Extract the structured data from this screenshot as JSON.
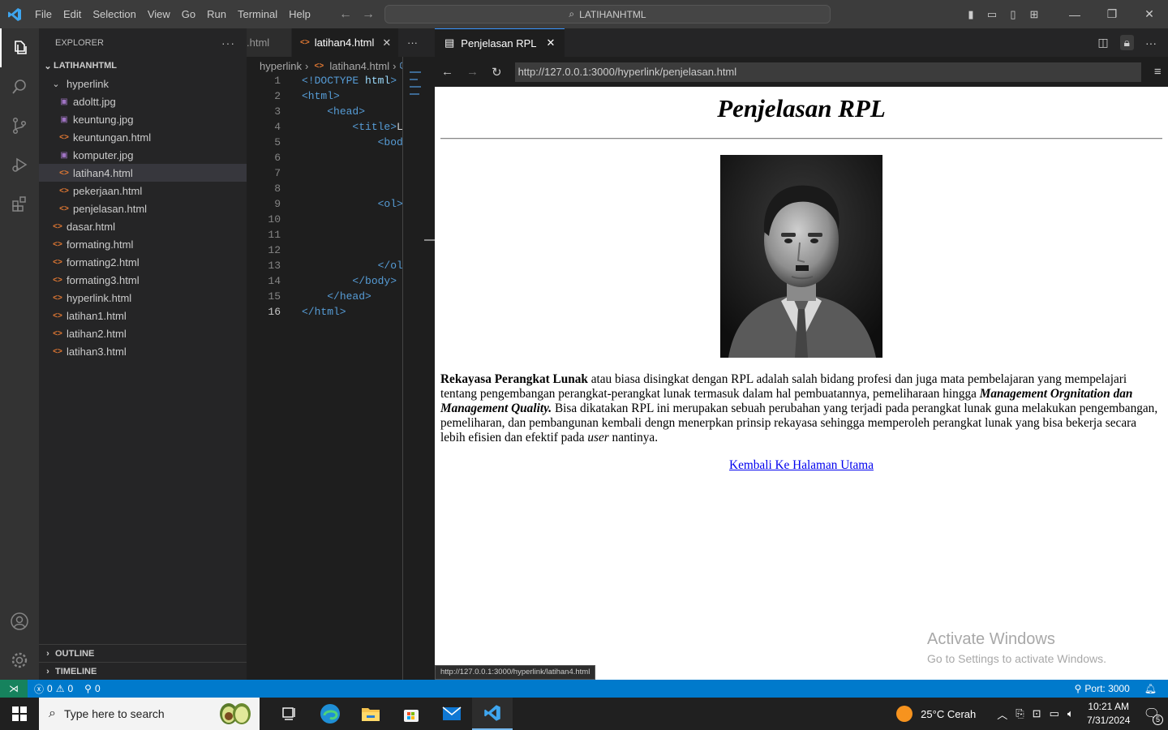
{
  "titlebar": {
    "menu": [
      "File",
      "Edit",
      "Selection",
      "View",
      "Go",
      "Run",
      "Terminal",
      "Help"
    ],
    "search_text": "LATIHANHTML"
  },
  "explorer": {
    "header": "EXPLORER",
    "root": "LATIHANHTML",
    "folder": "hyperlink",
    "folder_files": [
      {
        "name": "adoltt.jpg",
        "type": "img"
      },
      {
        "name": "keuntung.jpg",
        "type": "img"
      },
      {
        "name": "keuntungan.html",
        "type": "html"
      },
      {
        "name": "komputer.jpg",
        "type": "img"
      },
      {
        "name": "latihan4.html",
        "type": "html",
        "selected": true
      },
      {
        "name": "pekerjaan.html",
        "type": "html"
      },
      {
        "name": "penjelasan.html",
        "type": "html"
      }
    ],
    "root_files": [
      "dasar.html",
      "formating.html",
      "formating2.html",
      "formating3.html",
      "hyperlink.html",
      "latihan1.html",
      "latihan2.html",
      "latihan3.html"
    ],
    "outline": "OUTLINE",
    "timeline": "TIMELINE"
  },
  "editor": {
    "tab_prev": ".html",
    "tab_active": "latihan4.html",
    "breadcrumb": [
      "hyperlink",
      "latihan4.html",
      "htr"
    ],
    "lines": [
      {
        "n": "1",
        "html": "<span class='tg'>&lt;!DOCTYPE</span> <span class='at'>html</span><span class='tg'>&gt;</span>"
      },
      {
        "n": "2",
        "html": "<span class='tg'>&lt;html&gt;</span>"
      },
      {
        "n": "3",
        "html": "&nbsp;&nbsp;&nbsp;&nbsp;<span class='tg'>&lt;head&gt;</span>"
      },
      {
        "n": "4",
        "html": "&nbsp;&nbsp;&nbsp;&nbsp;&nbsp;&nbsp;&nbsp;&nbsp;<span class='tg'>&lt;title&gt;</span><span style='color:#d4d4d4'>L</span>"
      },
      {
        "n": "5",
        "html": "&nbsp;&nbsp;&nbsp;&nbsp;&nbsp;&nbsp;&nbsp;&nbsp;&nbsp;&nbsp;&nbsp;&nbsp;<span class='tg'>&lt;bod</span>"
      },
      {
        "n": "6",
        "html": ""
      },
      {
        "n": "7",
        "html": ""
      },
      {
        "n": "8",
        "html": ""
      },
      {
        "n": "9",
        "html": "&nbsp;&nbsp;&nbsp;&nbsp;&nbsp;&nbsp;&nbsp;&nbsp;&nbsp;&nbsp;&nbsp;&nbsp;<span class='tg'>&lt;ol&gt;</span>"
      },
      {
        "n": "10",
        "html": ""
      },
      {
        "n": "11",
        "html": ""
      },
      {
        "n": "12",
        "html": ""
      },
      {
        "n": "13",
        "html": "&nbsp;&nbsp;&nbsp;&nbsp;&nbsp;&nbsp;&nbsp;&nbsp;&nbsp;&nbsp;&nbsp;&nbsp;<span class='tg'>&lt;/ol</span>"
      },
      {
        "n": "14",
        "html": "&nbsp;&nbsp;&nbsp;&nbsp;&nbsp;&nbsp;&nbsp;&nbsp;<span class='tg'>&lt;/body&gt;</span>"
      },
      {
        "n": "15",
        "html": "&nbsp;&nbsp;&nbsp;&nbsp;<span class='tg'>&lt;/head&gt;</span>"
      },
      {
        "n": "16",
        "html": "<span class='tg'>&lt;/html&gt;</span>",
        "current": true
      }
    ]
  },
  "preview": {
    "tab_title": "Penjelasan RPL",
    "url": "http://127.0.0.1:3000/hyperlink/penjelasan.html",
    "heading": "Penjelasan RPL",
    "para_bold": "Rekayasa Perangkat Lunak",
    "para_1": " atau biasa disingkat dengan RPL adalah salah bidang profesi dan juga mata pembelajaran yang mempelajari tentang pengembangan perangkat-perangkat lunak termasuk dalam hal pembuatannya, pemeliharaan hingga ",
    "para_bi": "Management Orgnitation dan Management Quality.",
    "para_2": " Bisa dikatakan RPL ini merupakan sebuah perubahan yang terjadi pada perangkat lunak guna melakukan pengembangan, pemeliharan, dan pembangunan kembali dengn menerpkan prinsip rekayasa sehingga memperoleh perangkat lunak yang bisa bekerja secara lebih efisien dan efektif pada ",
    "para_i": "user",
    "para_3": " nantinya.",
    "link": "Kembali Ke Halaman Utama",
    "hover_url": "http://127.0.0.1:3000/hyperlink/latihan4.html",
    "watermark_1": "Activate Windows",
    "watermark_2": "Go to Settings to activate Windows."
  },
  "statusbar": {
    "errors": "0",
    "warnings": "0",
    "ports": "0",
    "port_label": "Port: 3000"
  },
  "taskbar": {
    "search_placeholder": "Type here to search",
    "weather": "25°C  Cerah",
    "time": "10:21 AM",
    "date": "7/31/2024",
    "notif_count": "5"
  }
}
